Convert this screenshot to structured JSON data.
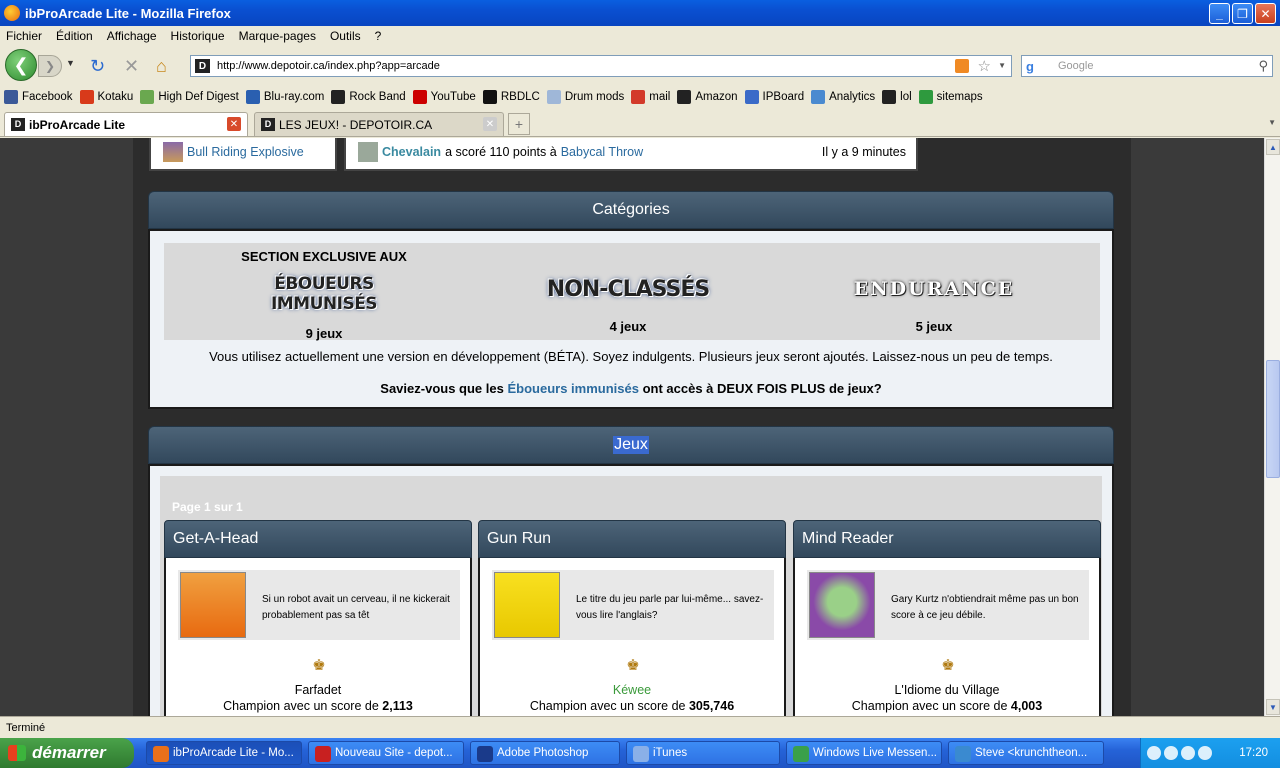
{
  "window": {
    "title": "ibProArcade Lite - Mozilla Firefox"
  },
  "menu": [
    "Fichier",
    "Édition",
    "Affichage",
    "Historique",
    "Marque-pages",
    "Outils",
    "?"
  ],
  "address": {
    "url": "http://www.depotoir.ca/index.php?app=arcade"
  },
  "search": {
    "placeholder": "Google"
  },
  "bookmarks": [
    {
      "label": "Facebook",
      "color": "#3b5998"
    },
    {
      "label": "Kotaku",
      "color": "#d83a1a"
    },
    {
      "label": "High Def Digest",
      "color": "#6aa84f"
    },
    {
      "label": "Blu-ray.com",
      "color": "#2a5fb0"
    },
    {
      "label": "Rock Band",
      "color": "#222222"
    },
    {
      "label": "YouTube",
      "color": "#cc0000"
    },
    {
      "label": "RBDLC",
      "color": "#111111"
    },
    {
      "label": "Drum mods",
      "color": "#9fb7d8"
    },
    {
      "label": "mail",
      "color": "#d33a2a"
    },
    {
      "label": "Amazon",
      "color": "#222222"
    },
    {
      "label": "IPBoard",
      "color": "#3a6ac8"
    },
    {
      "label": "Analytics",
      "color": "#4a8ad0"
    },
    {
      "label": "lol",
      "color": "#222222"
    },
    {
      "label": "sitemaps",
      "color": "#2e9a3e"
    }
  ],
  "tabs": [
    {
      "label": "ibProArcade Lite"
    },
    {
      "label": "LES JEUX! - DEPOTOIR.CA"
    }
  ],
  "recent": {
    "game_label": "Bull Riding Explosive",
    "player": "Chevalain",
    "middle": "a scoré 110 points à",
    "game": "Babycal Throw",
    "time": "Il y a 9 minutes"
  },
  "categories": {
    "header": "Catégories",
    "items": [
      {
        "logo_top": "SECTION EXCLUSIVE AUX",
        "logo_main": "ÉBOUEURS IMMUNISÉS",
        "count": "9 jeux"
      },
      {
        "logo_main": "NON-CLASSÉS",
        "count": "4 jeux"
      },
      {
        "logo_main": "ENDURANCE",
        "count": "5 jeux"
      }
    ],
    "notice": "Vous utilisez actuellement une version en développement (BÉTA). Soyez indulgents. Plusieurs jeux seront ajoutés. Laissez-nous un peu de temps.",
    "promo_before": "Saviez-vous que les",
    "promo_link": "Éboueurs immunisés",
    "promo_after": "ont accès à DEUX FOIS PLUS de jeux?"
  },
  "jeux": {
    "header": "Jeux",
    "page_label": "Page 1 sur 1",
    "games": [
      {
        "title": "Get-A-Head",
        "desc": "Si un robot avait un cerveau, il ne kickerait probablement pas sa têt",
        "champion": "Farfadet",
        "score_prefix": "Champion avec un score de",
        "score": "2,113"
      },
      {
        "title": "Gun Run",
        "desc": "Le titre du jeu parle par lui-même... savez-vous lire l'anglais?",
        "champion": "Kéwee",
        "score_prefix": "Champion avec un score de",
        "score": "305,746"
      },
      {
        "title": "Mind Reader",
        "desc": "Gary Kurtz n'obtiendrait même pas un bon score à ce jeu débile.",
        "champion": "L'Idiome du Village",
        "score_prefix": "Champion avec un score de",
        "score": "4,003"
      }
    ]
  },
  "status": {
    "text": "Terminé"
  },
  "taskbar": {
    "start": "démarrer",
    "items": [
      {
        "label": "ibProArcade Lite - Mo...",
        "color": "#e8701a"
      },
      {
        "label": "Nouveau Site - depot...",
        "color": "#c82020"
      },
      {
        "label": "Adobe Photoshop",
        "color": "#1a3a8a"
      },
      {
        "label": "iTunes",
        "color": "#8ab0e8"
      },
      {
        "label": "Windows Live Messen...",
        "color": "#3aa04a"
      },
      {
        "label": "Steve <krunchtheon...",
        "color": "#3a8ad0"
      }
    ],
    "clock": "17:20"
  }
}
